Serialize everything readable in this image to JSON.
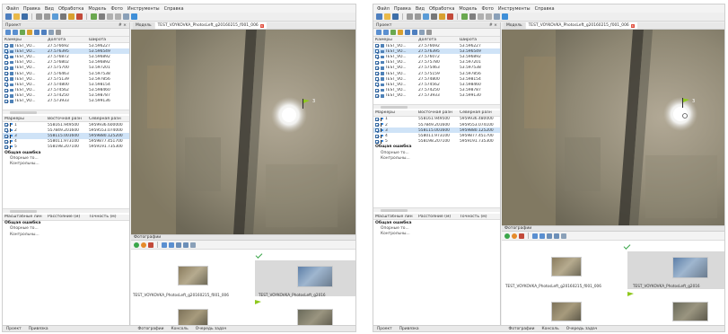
{
  "menu": [
    "Файл",
    "Правка",
    "Вид",
    "Обработка",
    "Модель",
    "Фото",
    "Инструменты",
    "Справка"
  ],
  "left_panel": {
    "workspace_title": "Проект",
    "pane_controls": "# ×",
    "cameras_headers": [
      "Камеры",
      "Долгота",
      "Широта"
    ],
    "markers_headers": [
      "Маркеры",
      "Восточная разн",
      "Северная разн"
    ],
    "scale_headers": [
      "Масштабные лин",
      "Расстояние (м)",
      "Точность (м)"
    ],
    "total_error": "Общая ошибка",
    "control_points": "Опорные то...",
    "check_points": "Контрольны...",
    "total_error_2": "Общая ошибка",
    "control_points_2": "Опорные то...",
    "check_points_2": "Контрольны..."
  },
  "w1": {
    "cameras": [
      {
        "name": "TEST_VO...",
        "lon": "27.576692",
        "lat": "53.596227"
      },
      {
        "name": "TEST_VO...",
        "lon": "27.576395",
        "lat": "53.596549"
      },
      {
        "name": "TEST_VO...",
        "lon": "27.576872",
        "lat": "53.596892"
      },
      {
        "name": "TEST_VO...",
        "lon": "27.576802",
        "lat": "53.596892"
      },
      {
        "name": "TEST_VO...",
        "lon": "27.575700",
        "lat": "53.597201"
      },
      {
        "name": "TEST_VO...",
        "lon": "27.576463",
        "lat": "53.597538"
      },
      {
        "name": "TEST_VO...",
        "lon": "27.575139",
        "lat": "53.597856"
      },
      {
        "name": "TEST_VO...",
        "lon": "27.574800",
        "lat": "53.598154"
      },
      {
        "name": "TEST_VO...",
        "lon": "27.574562",
        "lat": "53.598460"
      },
      {
        "name": "TEST_VO...",
        "lon": "27.574250",
        "lat": "53.598787"
      },
      {
        "name": "TEST_VO...",
        "lon": "27.573933",
        "lat": "53.599136"
      }
    ],
    "markers": [
      {
        "name": "1",
        "east": "558161.949500",
        "north": "5959936.600000"
      },
      {
        "name": "2",
        "east": "557849.201600",
        "north": "5959553.074000"
      },
      {
        "name": "3",
        "east": "558115.001600",
        "north": "5959880.125200"
      },
      {
        "name": "4",
        "east": "558011.973100",
        "north": "5959877.451700"
      },
      {
        "name": "5",
        "east": "558198.207100",
        "north": "5959191.735300"
      }
    ],
    "view_tabs": [
      "Модель",
      "TEST_VOYKOVKA_PhotosLeft_g20160215_f001_006"
    ],
    "photos_title": "Фотографии",
    "photos": [
      {
        "caption": "TEST_VOYKOVKA_PhotosLeft_g20160215_f001_006"
      },
      {
        "caption": "TEST_VOYKOVKA_PhotosLeft_g2016"
      }
    ],
    "bottom_tabs_left": [
      "Проект",
      "Привязка"
    ],
    "bottom_tabs_right": [
      "Фотографии",
      "Консоль",
      "Очередь задач"
    ],
    "marker_label": "3"
  },
  "w2": {
    "cameras": [
      {
        "name": "TEST_VO...",
        "lon": "27.576692",
        "lat": "53.596227"
      },
      {
        "name": "TEST_VO...",
        "lon": "27.576395",
        "lat": "53.596549"
      },
      {
        "name": "TEST_VO...",
        "lon": "27.576072",
        "lat": "53.596892"
      },
      {
        "name": "TEST_VO...",
        "lon": "27.575780",
        "lat": "53.597201"
      },
      {
        "name": "TEST_VO...",
        "lon": "27.575463",
        "lat": "53.597538"
      },
      {
        "name": "TEST_VO...",
        "lon": "27.575159",
        "lat": "53.597856"
      },
      {
        "name": "TEST_VO...",
        "lon": "27.574800",
        "lat": "53.598154"
      },
      {
        "name": "TEST_VO...",
        "lon": "27.574562",
        "lat": "53.598460"
      },
      {
        "name": "TEST_VO...",
        "lon": "27.574250",
        "lat": "53.598787"
      },
      {
        "name": "TEST_VO...",
        "lon": "27.573933",
        "lat": "53.599130"
      }
    ],
    "markers": [
      {
        "name": "1",
        "east": "558161.949500",
        "north": "5959936.480000"
      },
      {
        "name": "2",
        "east": "557849.201600",
        "north": "5959553.074100"
      },
      {
        "name": "3",
        "east": "558115.001600",
        "north": "5959880.125200"
      },
      {
        "name": "4",
        "east": "558011.973100",
        "north": "5959877.451700"
      },
      {
        "name": "5",
        "east": "558198.207100",
        "north": "5959191.735300"
      }
    ],
    "view_tabs": [
      "Модель",
      "TEST_VOYKOVKA_PhotosLeft_g20160215_f001_006"
    ],
    "photos_title": "Фотографии",
    "photos": [
      {
        "caption": "TEST_VOYKOVKA_PhotosLeft_g20160215_f001_006"
      },
      {
        "caption": "TEST_VOYKOVKA_PhotosLeft_g2016"
      }
    ],
    "bottom_tabs_left": [
      "Проект",
      "Привязка"
    ],
    "bottom_tabs_right": [
      "Фотографии",
      "Консоль",
      "Очередь задач"
    ],
    "marker_label": "3"
  },
  "icons": [
    "camera-icon",
    "flag-icon",
    "checkbox-icon",
    "close-icon",
    "check-mark-icon",
    "marker-flag-icon"
  ],
  "colors": {
    "selection": "#cfe3f7",
    "check": "#3aa64a",
    "flag_selected": "#8fc81e",
    "flag": "#3b8ee8",
    "tab_close": "#e04b3b"
  }
}
